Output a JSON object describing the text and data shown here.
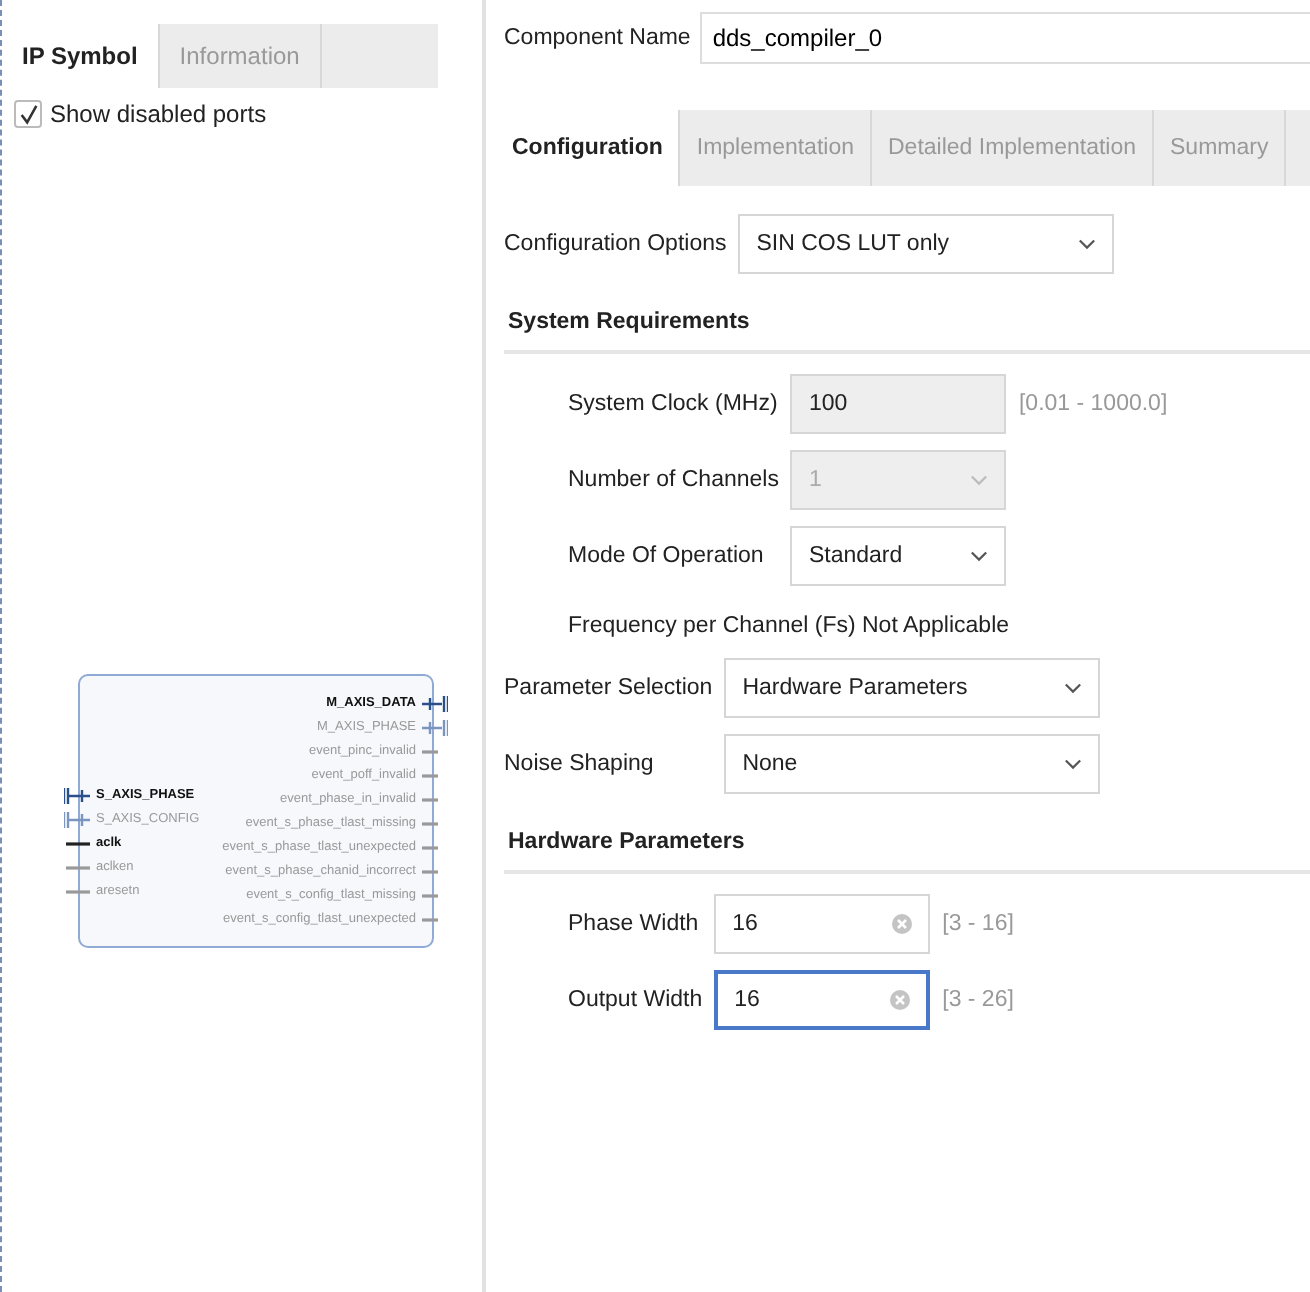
{
  "left_tabs": [
    {
      "label": "IP Symbol",
      "selected": true
    },
    {
      "label": "Information",
      "selected": false
    }
  ],
  "show_disabled_ports": {
    "label": "Show disabled ports",
    "checked": true
  },
  "symbol": {
    "left_ports": [
      {
        "name": "S_AXIS_PHASE",
        "kind": "bus",
        "enabled": true
      },
      {
        "name": "S_AXIS_CONFIG",
        "kind": "bus",
        "enabled": false
      },
      {
        "name": "aclk",
        "kind": "wire",
        "enabled": true
      },
      {
        "name": "aclken",
        "kind": "wire",
        "enabled": false
      },
      {
        "name": "aresetn",
        "kind": "wire",
        "enabled": false
      }
    ],
    "right_ports": [
      {
        "name": "M_AXIS_DATA",
        "kind": "bus",
        "enabled": true
      },
      {
        "name": "M_AXIS_PHASE",
        "kind": "bus",
        "enabled": false
      },
      {
        "name": "event_pinc_invalid",
        "kind": "wire",
        "enabled": false
      },
      {
        "name": "event_poff_invalid",
        "kind": "wire",
        "enabled": false
      },
      {
        "name": "event_phase_in_invalid",
        "kind": "wire",
        "enabled": false
      },
      {
        "name": "event_s_phase_tlast_missing",
        "kind": "wire",
        "enabled": false
      },
      {
        "name": "event_s_phase_tlast_unexpected",
        "kind": "wire",
        "enabled": false
      },
      {
        "name": "event_s_phase_chanid_incorrect",
        "kind": "wire",
        "enabled": false
      },
      {
        "name": "event_s_config_tlast_missing",
        "kind": "wire",
        "enabled": false
      },
      {
        "name": "event_s_config_tlast_unexpected",
        "kind": "wire",
        "enabled": false
      }
    ]
  },
  "component_name": {
    "label": "Component Name",
    "value": "dds_compiler_0"
  },
  "tabs": [
    {
      "label": "Configuration",
      "selected": true
    },
    {
      "label": "Implementation",
      "selected": false
    },
    {
      "label": "Detailed Implementation",
      "selected": false
    },
    {
      "label": "Summary",
      "selected": false
    }
  ],
  "groups": [
    {
      "kind": "plain",
      "rows": [
        {
          "kind": "select",
          "label": "Configuration Options",
          "value": "SIN COS LUT only",
          "disabled": false,
          "focused": false
        }
      ]
    },
    {
      "kind": "section",
      "title": "System Requirements",
      "rows": [
        {
          "kind": "text",
          "label": "System Clock (MHz)",
          "value": "100",
          "range": "[0.01 - 1000.0]",
          "disabled": true,
          "focused": false
        },
        {
          "kind": "select",
          "label": "Number of Channels",
          "value": "1",
          "disabled": true,
          "focused": false
        },
        {
          "kind": "select",
          "label": "Mode Of Operation",
          "value": "Standard",
          "disabled": false,
          "focused": false
        }
      ],
      "note": "Frequency per Channel (Fs) Not Applicable"
    },
    {
      "kind": "plain",
      "rows": [
        {
          "kind": "select",
          "label": "Parameter Selection",
          "value": "Hardware Parameters",
          "disabled": false,
          "focused": false
        },
        {
          "kind": "select",
          "label": "Noise Shaping",
          "value": "None",
          "disabled": false,
          "focused": false
        }
      ]
    },
    {
      "kind": "section",
      "title": "Hardware Parameters",
      "rows": [
        {
          "kind": "number",
          "label": "Phase Width",
          "value": "16",
          "range": "[3 - 16]",
          "disabled": false,
          "focused": false
        },
        {
          "kind": "number",
          "label": "Output Width",
          "value": "16",
          "range": "[3 - 26]",
          "disabled": false,
          "focused": true
        }
      ]
    }
  ]
}
